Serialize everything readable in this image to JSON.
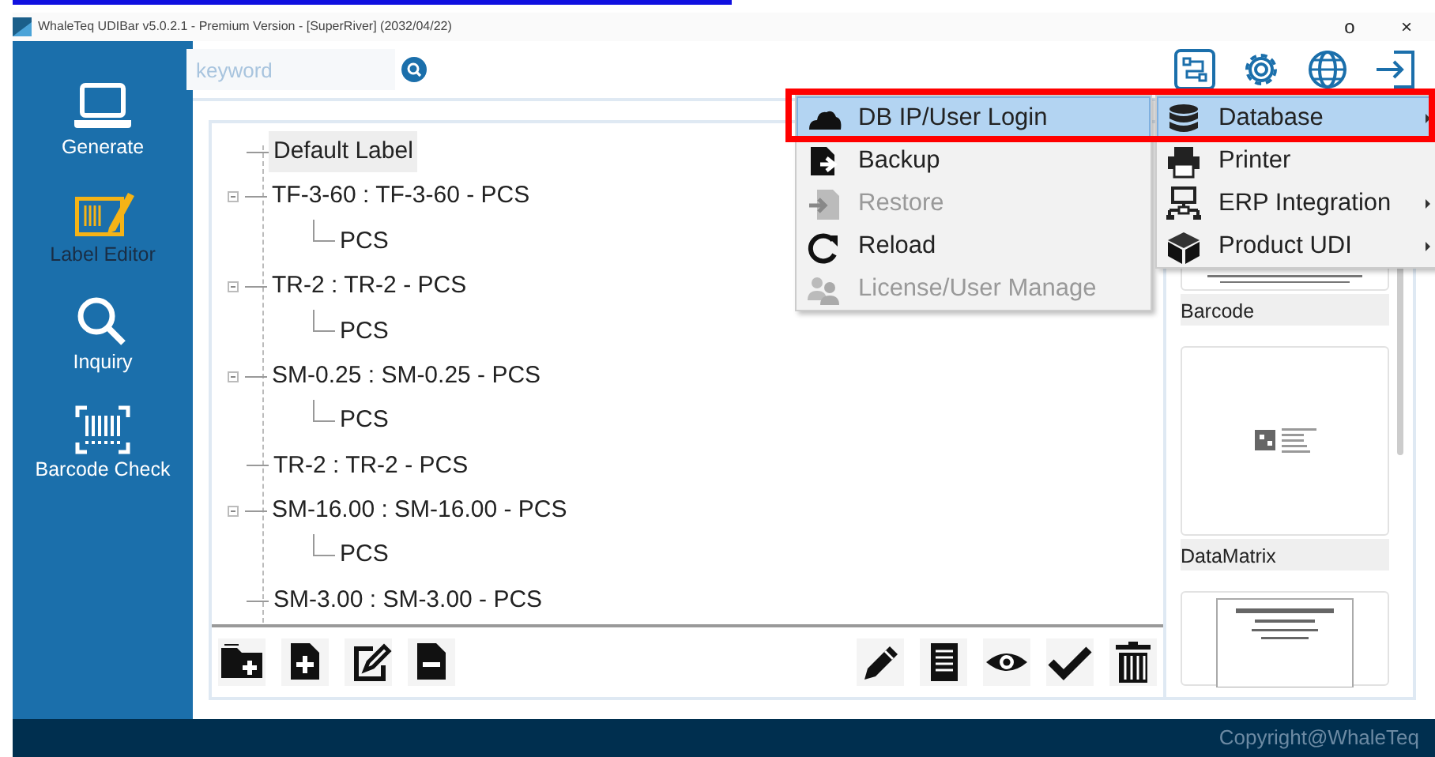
{
  "window": {
    "title": "WhaleTeq UDIBar v5.0.2.1 - Premium Version - [SuperRiver] (2032/04/22)",
    "controls": [
      "o",
      "×"
    ]
  },
  "sidebar": {
    "items": [
      {
        "label": "Generate",
        "kind": "generate",
        "selected": false
      },
      {
        "label": "Label Editor",
        "kind": "editor",
        "selected": true
      },
      {
        "label": "Inquiry",
        "kind": "inquiry",
        "selected": false
      },
      {
        "label": "Barcode Check",
        "kind": "barcode",
        "selected": false
      }
    ]
  },
  "search": {
    "placeholder": "keyword"
  },
  "tree": [
    {
      "label": "Default Label",
      "selected": true
    },
    {
      "label": "TF-3-60 : TF-3-60 - PCS",
      "selected": false,
      "expanded": true,
      "children": [
        {
          "label": "PCS",
          "selected": false
        }
      ]
    },
    {
      "label": "TR-2 : TR-2 - PCS",
      "selected": false,
      "expanded": true,
      "children": [
        {
          "label": "PCS",
          "selected": false
        }
      ]
    },
    {
      "label": "SM-0.25 : SM-0.25 - PCS",
      "selected": false,
      "expanded": true,
      "children": [
        {
          "label": "PCS",
          "selected": false
        }
      ]
    },
    {
      "label": "TR-2 : TR-2 - PCS",
      "selected": false
    },
    {
      "label": "SM-16.00 : SM-16.00 - PCS",
      "selected": false,
      "expanded": true,
      "children": [
        {
          "label": "PCS",
          "selected": false
        }
      ]
    },
    {
      "label": "SM-3.00 : SM-3.00 - PCS",
      "selected": false
    }
  ],
  "templates": [
    {
      "label": "Barcode",
      "kind": "barcode"
    },
    {
      "label": "DataMatrix",
      "kind": "datamatrix"
    },
    {
      "kind": "document"
    }
  ],
  "menu": {
    "items": [
      {
        "label": "DB IP/User Login",
        "kind": "cloud",
        "selected": true,
        "disabled": false
      },
      {
        "label": "Backup",
        "kind": "backup",
        "selected": false,
        "disabled": false
      },
      {
        "label": "Restore",
        "kind": "restore",
        "selected": false,
        "disabled": true
      },
      {
        "label": "Reload",
        "kind": "reload",
        "selected": false,
        "disabled": false
      },
      {
        "label": "License/User Manage",
        "kind": "users",
        "selected": false,
        "disabled": true
      }
    ]
  },
  "submenu": {
    "items": [
      {
        "label": "Database",
        "kind": "database",
        "selected": true,
        "has_submenu": true
      },
      {
        "label": "Printer",
        "kind": "printer",
        "selected": false,
        "has_submenu": false
      },
      {
        "label": "ERP Integration",
        "kind": "network",
        "selected": false,
        "has_submenu": true
      },
      {
        "label": "Product UDI",
        "kind": "box",
        "selected": false,
        "has_submenu": true
      }
    ]
  },
  "highlight_box": true,
  "footer": {
    "text": "Copyright@WhaleTeq"
  }
}
